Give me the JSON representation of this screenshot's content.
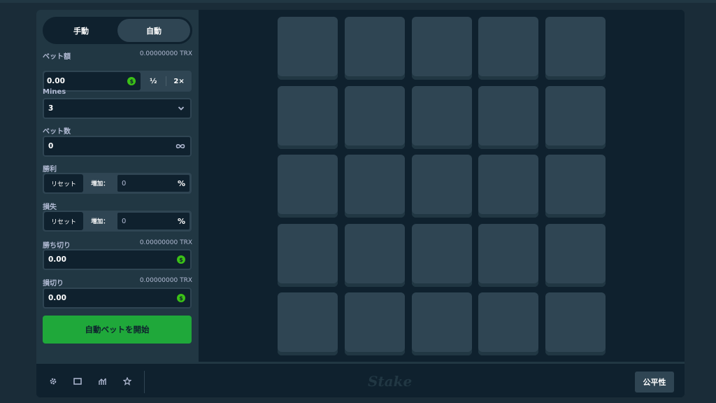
{
  "mode": {
    "manual": "手動",
    "auto": "自動",
    "active": "auto"
  },
  "bet_amount": {
    "label": "ベット額",
    "balance": "0.00000000 TRX",
    "value": "0.00",
    "half": "½",
    "double": "2×"
  },
  "mines": {
    "label": "Mines",
    "value": "3"
  },
  "num_bets": {
    "label": "ベット数",
    "value": "0"
  },
  "on_win": {
    "label": "勝利",
    "reset": "リセット",
    "increase": "増加：",
    "value": "0",
    "unit": "%"
  },
  "on_loss": {
    "label": "損失",
    "reset": "リセット",
    "increase": "増加：",
    "value": "0",
    "unit": "%"
  },
  "stop_profit": {
    "label": "勝ち切り",
    "balance": "0.00000000 TRX",
    "value": "0.00"
  },
  "stop_loss": {
    "label": "損切り",
    "balance": "0.00000000 TRX",
    "value": "0.00"
  },
  "coin_symbol": "$",
  "start_button": "自動ベットを開始",
  "footer": {
    "logo": "Stake",
    "fairness": "公平性"
  },
  "colors": {
    "accent_green": "#1fa83a",
    "coin_green": "#3bc117",
    "tile": "#2f4553",
    "bg": "#0f212e"
  },
  "grid": {
    "rows": 5,
    "cols": 5
  }
}
